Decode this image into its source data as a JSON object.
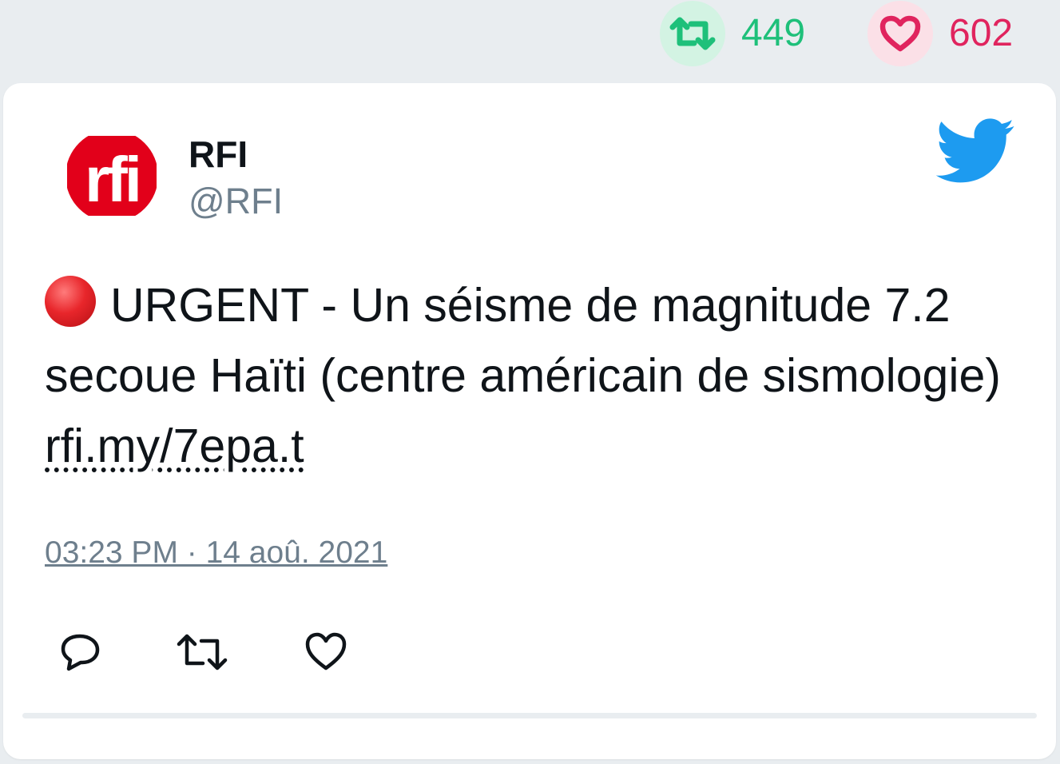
{
  "stats": {
    "retweet_count": "449",
    "like_count": "602"
  },
  "author": {
    "name": "RFI",
    "handle": "@RFI",
    "avatar_logo_text": "rfi"
  },
  "tweet": {
    "text": "URGENT - Un séisme de magnitude 7.2 secoue Haïti (centre américain de sismologie) ",
    "link": "rfi.my/7epa.t",
    "timestamp": "03:23 PM · 14 aoû. 2021"
  },
  "icons": {
    "urgent": "red-circle-icon",
    "brand": "twitter-bird-icon",
    "reply": "reply-icon",
    "retweet": "retweet-icon",
    "like": "heart-icon"
  },
  "colors": {
    "retweet_green": "#1ec07a",
    "like_pink": "#e0245e",
    "twitter_blue": "#1d9bf0",
    "rfi_red": "#e2001a",
    "muted_text": "#6e7f8d"
  }
}
